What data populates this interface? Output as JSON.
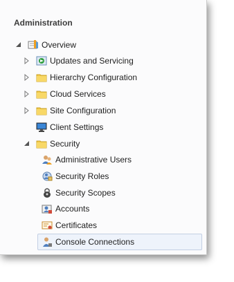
{
  "section": {
    "title": "Administration"
  },
  "tree": {
    "overview": "Overview",
    "updates": "Updates and Servicing",
    "hierarchy": "Hierarchy Configuration",
    "cloud": "Cloud Services",
    "site": "Site Configuration",
    "client": "Client Settings",
    "security": "Security",
    "admin_users": "Administrative Users",
    "security_roles": "Security Roles",
    "security_scopes": "Security Scopes",
    "accounts": "Accounts",
    "certificates": "Certificates",
    "console_connections": "Console Connections"
  },
  "colors": {
    "folder": "#f3c947",
    "selection_bg": "#eef3fb",
    "selection_border": "#c3cfe3"
  }
}
